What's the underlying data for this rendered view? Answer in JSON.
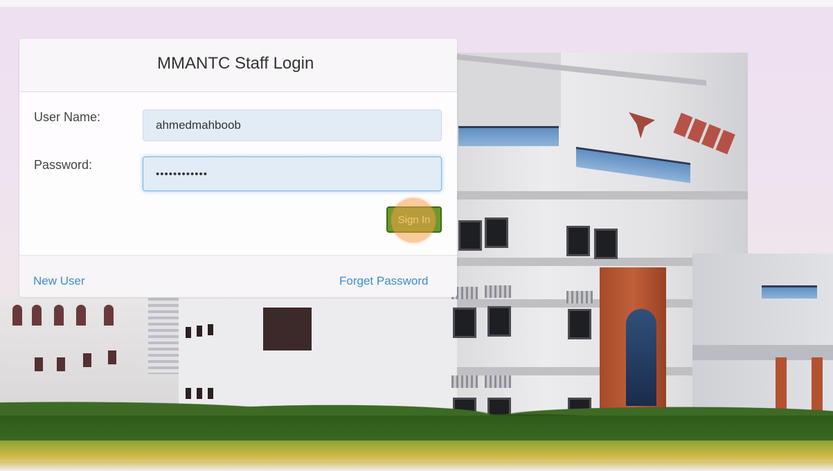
{
  "login": {
    "title": "MMANTC Staff Login",
    "username_label": "User Name:",
    "username_value": "ahmedmahboob",
    "password_label": "Password:",
    "password_value": "••••••••••••",
    "signin_label": "Sign In",
    "new_user_link": "New User",
    "forget_password_link": "Forget Password"
  },
  "colors": {
    "link": "#3b8ed0",
    "signin_button": "#6a9a2a",
    "input_bg": "#e2ecf7",
    "focus_glow": "#66afe9",
    "click_indicator": "#f5a046"
  }
}
